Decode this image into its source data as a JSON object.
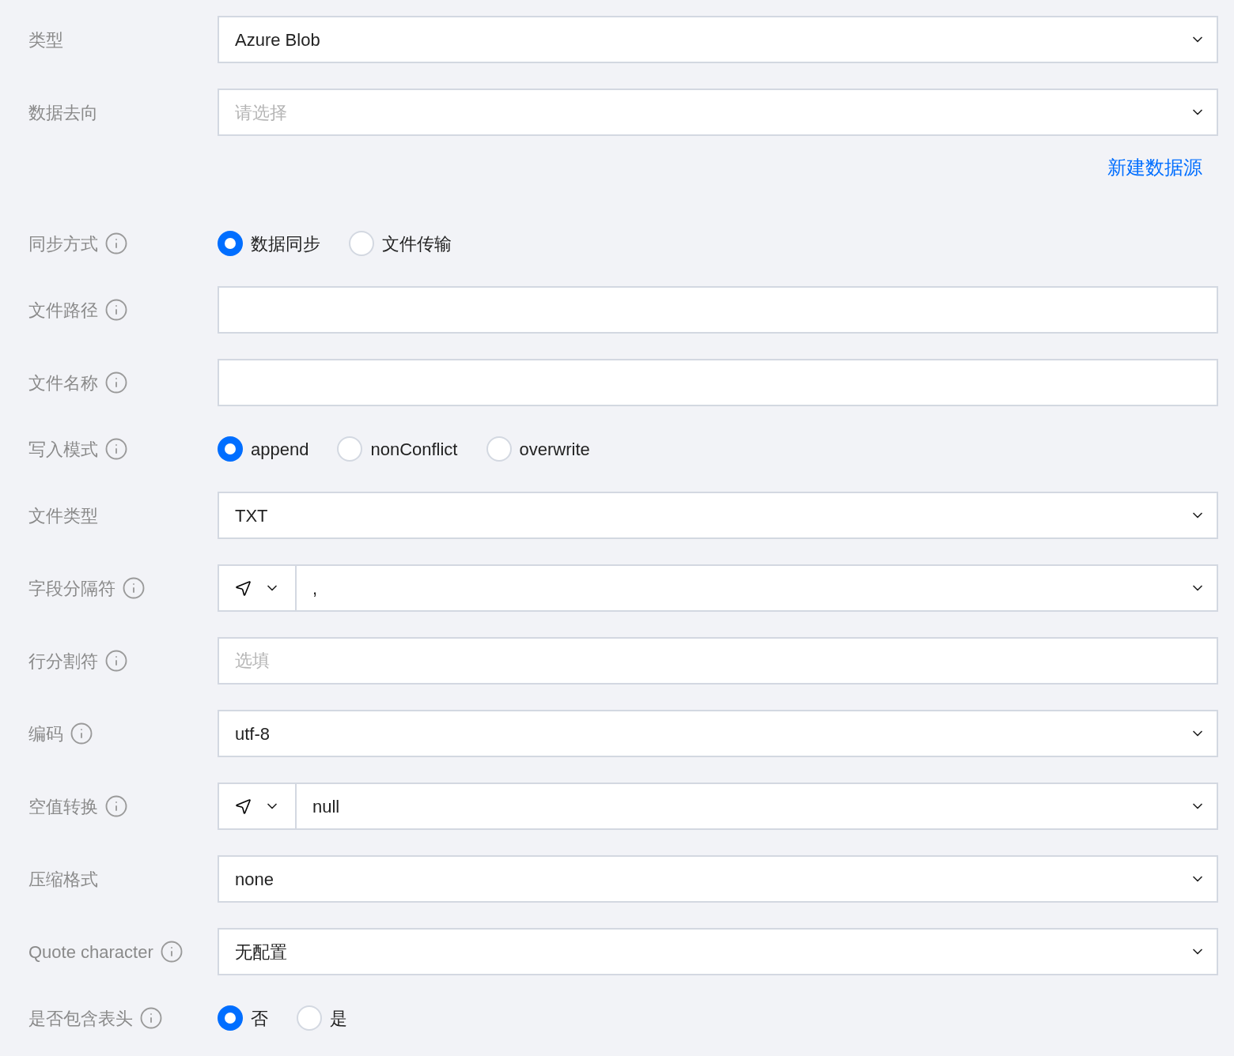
{
  "rows": [
    {
      "kind": "select",
      "label": "类型",
      "info": false,
      "value": "Azure Blob"
    },
    {
      "kind": "select",
      "label": "数据去向",
      "info": false,
      "placeholder": "请选择",
      "link": "新建数据源"
    },
    {
      "kind": "radio",
      "label": "同步方式",
      "info": true,
      "options": [
        {
          "label": "数据同步",
          "selected": true
        },
        {
          "label": "文件传输",
          "selected": false
        }
      ]
    },
    {
      "kind": "input",
      "label": "文件路径",
      "info": true
    },
    {
      "kind": "input",
      "label": "文件名称",
      "info": true
    },
    {
      "kind": "radio",
      "label": "写入模式",
      "info": true,
      "options": [
        {
          "label": "append",
          "selected": true
        },
        {
          "label": "nonConflict",
          "selected": false
        },
        {
          "label": "overwrite",
          "selected": false
        }
      ]
    },
    {
      "kind": "select",
      "label": "文件类型",
      "info": false,
      "value": "TXT"
    },
    {
      "kind": "split",
      "label": "字段分隔符",
      "info": true,
      "value": ","
    },
    {
      "kind": "input",
      "label": "行分割符",
      "info": true,
      "placeholder": "选填"
    },
    {
      "kind": "select",
      "label": "编码",
      "info": true,
      "value": "utf-8"
    },
    {
      "kind": "split",
      "label": "空值转换",
      "info": true,
      "value": "null"
    },
    {
      "kind": "select",
      "label": "压缩格式",
      "info": false,
      "value": "none"
    },
    {
      "kind": "select",
      "label": "Quote character",
      "info": true,
      "value": "无配置"
    },
    {
      "kind": "radio",
      "label": "是否包含表头",
      "info": true,
      "options": [
        {
          "label": "否",
          "selected": true
        },
        {
          "label": "是",
          "selected": false
        }
      ]
    }
  ]
}
